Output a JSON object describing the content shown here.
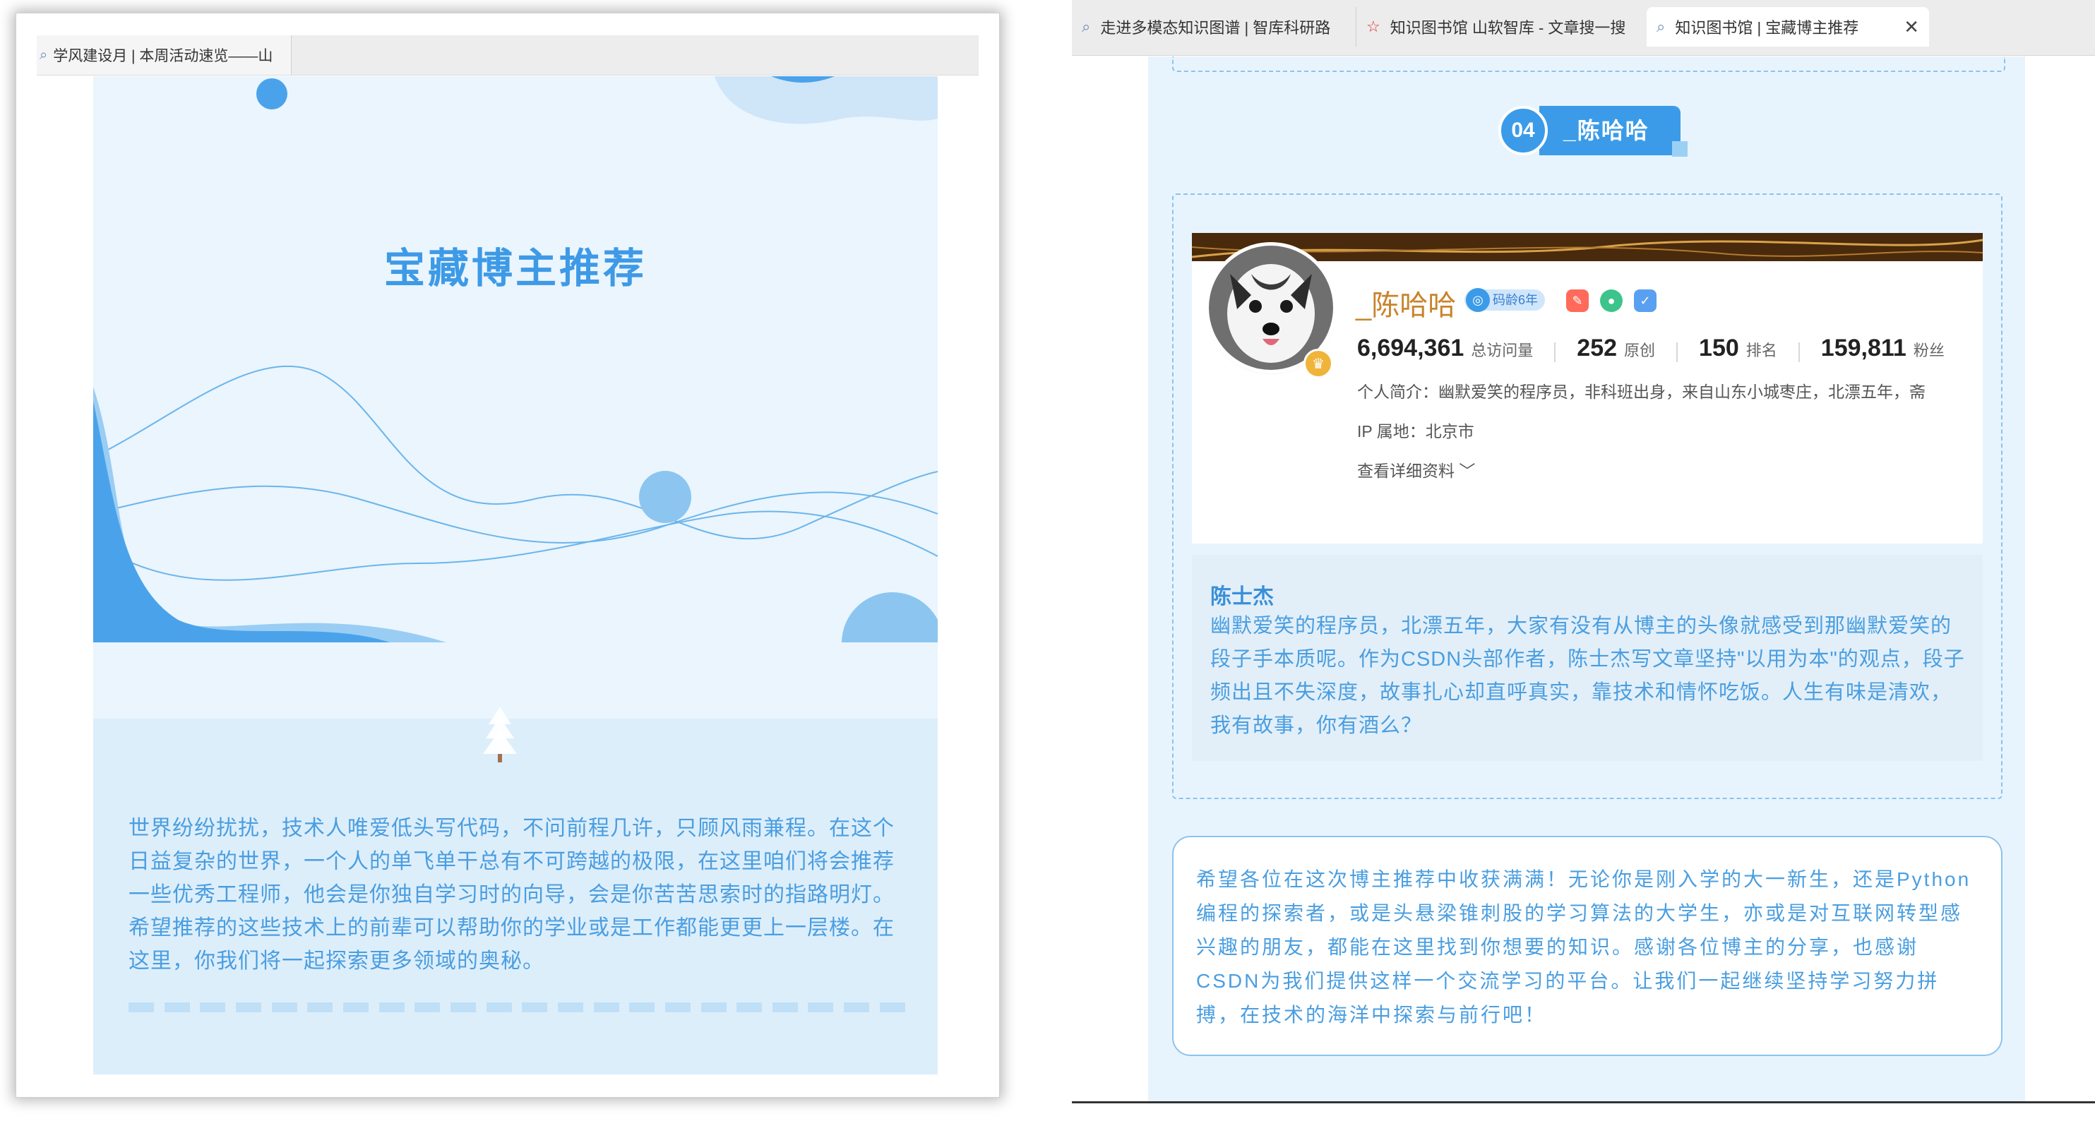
{
  "left_window": {
    "tab_title": "学风建设月 | 本周活动速览——山",
    "banner_title": "宝藏博主推荐",
    "intro_text": "世界纷纷扰扰，技术人唯爱低头写代码，不问前程几许，只顾风雨兼程。在这个日益复杂的世界，一个人的单飞单干总有不可跨越的极限，在这里咱们将会推荐一些优秀工程师，他会是你独自学习时的向导，会是你苦苦思索时的指路明灯。希望推荐的这些技术上的前辈可以帮助你的学业或是工作都能更更上一层楼。在这里，你我们将一起探索更多领域的奥秘。"
  },
  "right_window": {
    "tabs": [
      {
        "label": "走进多模态知识图谱 | 智库科研路",
        "icon": "page-icon"
      },
      {
        "label": "知识图书馆 山软智库 - 文章搜一搜",
        "icon": "star-icon"
      },
      {
        "label": "知识图书馆 | 宝藏博主推荐",
        "icon": "page-icon",
        "close": "✕"
      }
    ],
    "section": {
      "number": "04",
      "label": "_陈哈哈"
    },
    "blogger": {
      "name": "_陈哈哈",
      "age_badge": "码龄6年",
      "stats": [
        {
          "value": "6,694,361",
          "label": "总访问量"
        },
        {
          "value": "252",
          "label": "原创"
        },
        {
          "value": "150",
          "label": "排名"
        },
        {
          "value": "159,811",
          "label": "粉丝"
        }
      ],
      "bio": "个人简介：幽默爱笑的程序员，非科班出身，来自山东小城枣庄，北漂五年，斋",
      "ip": "IP 属地：北京市",
      "more": "查看详细资料"
    },
    "comment": {
      "author": "陈士杰",
      "text": "幽默爱笑的程序员，北漂五年，大家有没有从博主的头像就感受到那幽默爱笑的段子手本质呢。作为CSDN头部作者，陈士杰写文章坚持\"以用为本\"的观点，段子频出且不失深度，故事扎心却直呼真实，靠技术和情怀吃饭。人生有味是清欢，我有故事，你有酒么？"
    },
    "closing": "希望各位在这次博主推荐中收获满满！无论你是刚入学的大一新生，还是Python编程的探索者，或是头悬梁锥刺股的学习算法的大学生，亦或是对互联网转型感兴趣的朋友，都能在这里找到你想要的知识。感谢各位博主的分享，也感谢CSDN为我们提供这样一个交流学习的平台。让我们一起继续坚持学习努力拼搏，在技术的海洋中探索与前行吧！"
  },
  "colors": {
    "accent_blue": "#3b9be8",
    "text_blue": "#4a9ee0",
    "name_gold": "#c8842c",
    "page_bg": "#eaf5fd"
  }
}
